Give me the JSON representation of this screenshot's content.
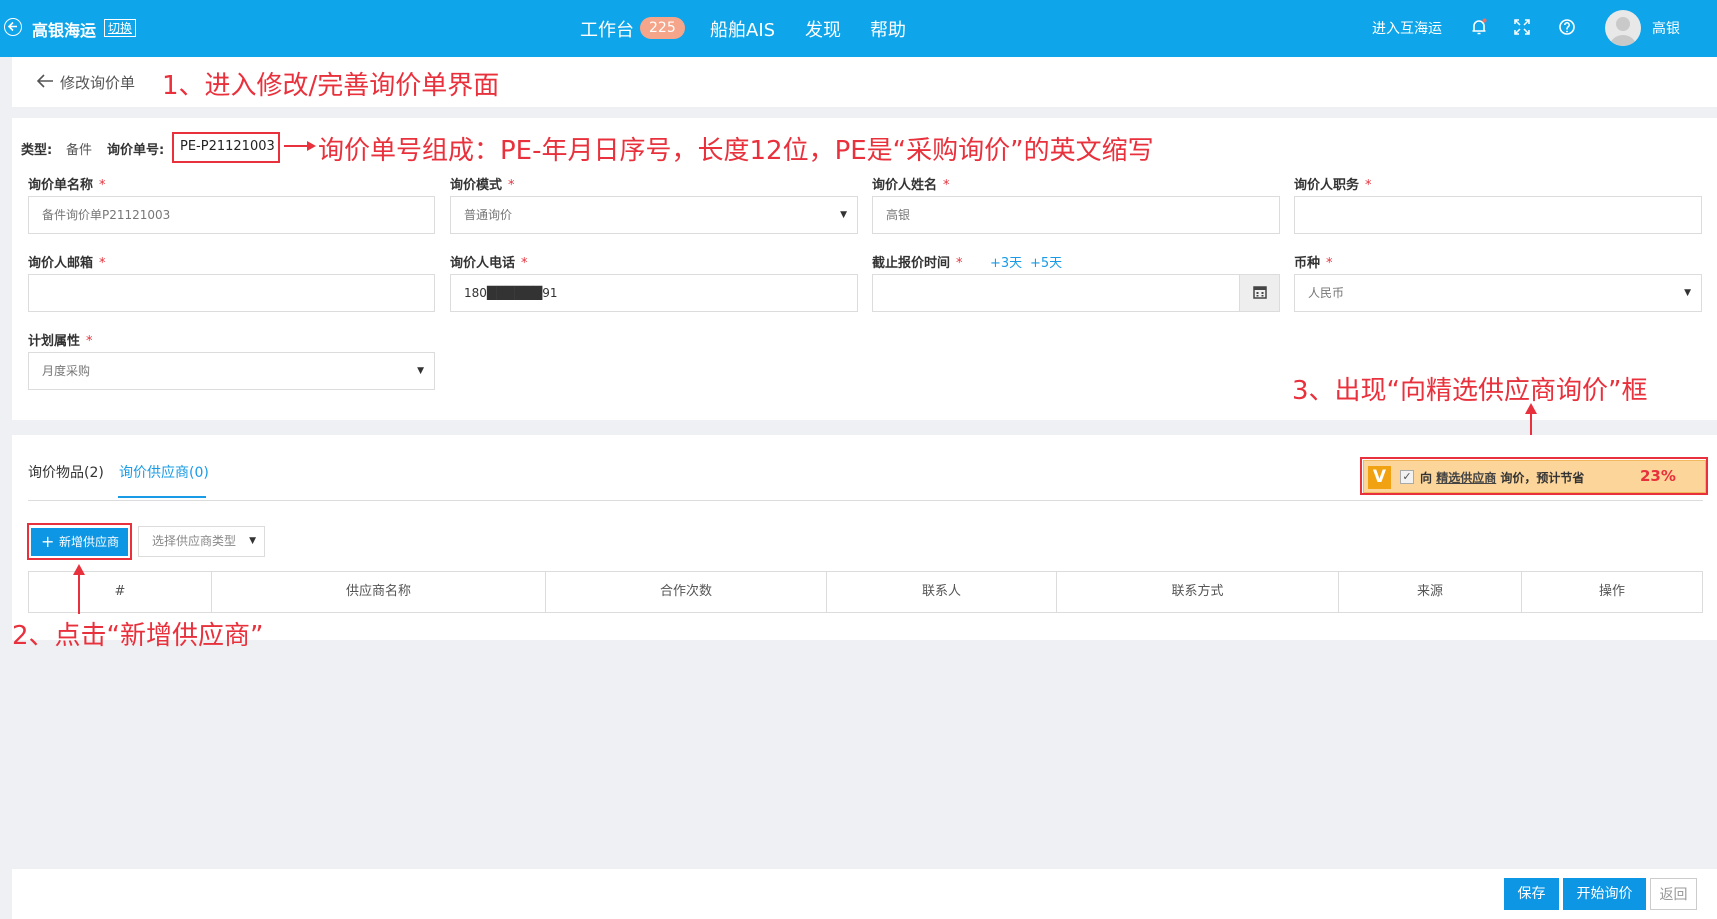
{
  "header": {
    "brand": "高银海运",
    "switch_label": "切换",
    "nav": [
      {
        "label": "工作台"
      },
      {
        "label": "船舶AIS"
      },
      {
        "label": "发现"
      },
      {
        "label": "帮助"
      }
    ],
    "workbench_badge": "225",
    "enter_link": "进入互海运",
    "user_name": "高银"
  },
  "page": {
    "title": "修改询价单",
    "annotation_1": "1、进入修改/完善询价单界面"
  },
  "meta": {
    "type_label": "类型:",
    "type_value": "备件",
    "no_label": "询价单号:",
    "no_value": "PE-P21121003",
    "annotation": "询价单号组成：PE-年月日序号，长度12位，PE是“采购询价”的英文缩写"
  },
  "form": {
    "name_label": "询价单名称",
    "name_value": "备件询价单P21121003",
    "mode_label": "询价模式",
    "mode_value": "普通询价",
    "person_label": "询价人姓名",
    "person_value": "高银",
    "position_label": "询价人职务",
    "position_value": "",
    "email_label": "询价人邮箱",
    "email_value": "",
    "phone_label": "询价人电话",
    "phone_value": "180██████91",
    "deadline_label": "截止报价时间",
    "deadline_value": "",
    "plus3": "+3天",
    "plus5": "+5天",
    "currency_label": "币种",
    "currency_value": "人民币",
    "plan_label": "计划属性",
    "plan_value": "月度采购",
    "required_mark": "*"
  },
  "tabs": [
    {
      "label": "询价物品(2)"
    },
    {
      "label": "询价供应商(0)"
    }
  ],
  "promo": {
    "badge": "V",
    "prefix": "向",
    "link": "精选供应商",
    "suffix": "询价，预计节省",
    "percent": "23%",
    "annotation": "3、出现“向精选供应商询价”框"
  },
  "supplier": {
    "add_button": "新增供应商",
    "type_placeholder": "选择供应商类型",
    "annotation": "2、点击“新增供应商”"
  },
  "table": {
    "columns": [
      "#",
      "供应商名称",
      "合作次数",
      "联系人",
      "联系方式",
      "来源",
      "操作"
    ]
  },
  "footer": {
    "save": "保存",
    "start": "开始询价",
    "back": "返回"
  },
  "colors": {
    "topbar": "#0ea5ea",
    "primary_button": "#0d96e4",
    "annotation_red": "#e8313c",
    "promo_bg": "#fbd59a"
  }
}
